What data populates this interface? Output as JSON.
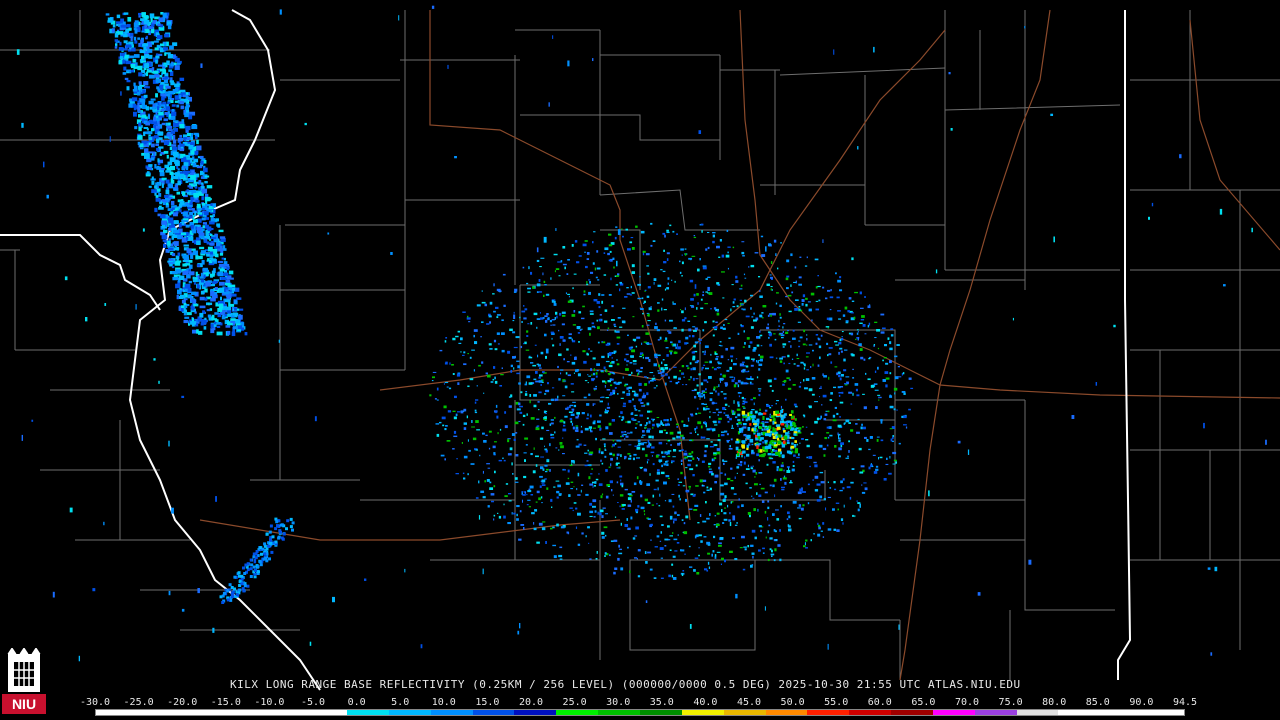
{
  "caption": "KILX LONG RANGE BASE REFLECTIVITY (0.25KM / 256 LEVEL) (000000/0000 0.5 DEG) 2025-10-30 21:55 UTC  ATLAS.NIU.EDU",
  "logo_text": "NIU",
  "colors": {
    "background": "#000000",
    "county_lines": "#6e6e6e",
    "state_lines": "#ffffff",
    "highways": "#8b4a2b",
    "logo_red": "#c8102e"
  },
  "scale": {
    "labels": [
      "-30.0",
      "-25.0",
      "-20.0",
      "-15.0",
      "-10.0",
      "-5.0",
      "0.0",
      "5.0",
      "10.0",
      "15.0",
      "20.0",
      "25.0",
      "30.0",
      "35.0",
      "40.0",
      "45.0",
      "50.0",
      "55.0",
      "60.0",
      "65.0",
      "70.0",
      "75.0",
      "80.0",
      "85.0",
      "90.0",
      "94.5"
    ],
    "colors": [
      "#ffffff",
      "#ffffff",
      "#ffffff",
      "#ffffff",
      "#ffffff",
      "#ffffff",
      "#00e0f0",
      "#00b8ff",
      "#0090ff",
      "#0050e8",
      "#0010c0",
      "#00f000",
      "#00c000",
      "#008f00",
      "#f0f000",
      "#e8b800",
      "#ff8a00",
      "#ff2000",
      "#d00000",
      "#a00000",
      "#ff00ff",
      "#9a40e0",
      "#e0e0e0",
      "#ffffff",
      "#ffffff",
      "#ffffff"
    ]
  }
}
